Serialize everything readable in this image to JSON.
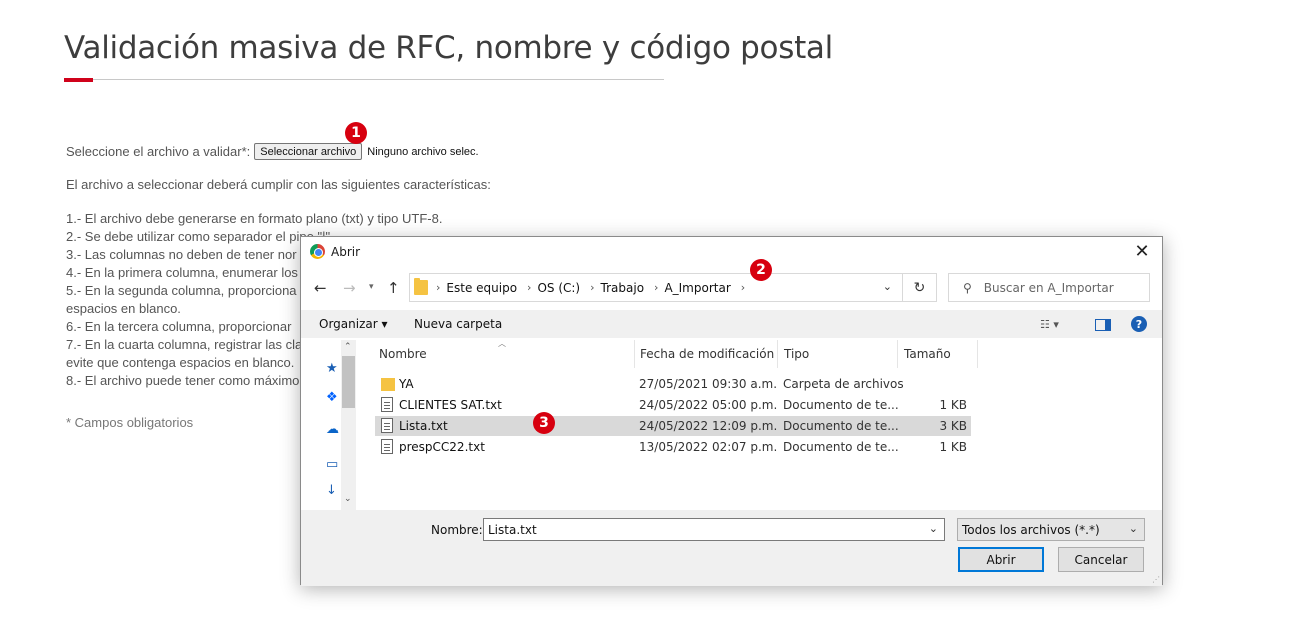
{
  "page": {
    "title": "Validación masiva de RFC, nombre y código postal",
    "select_label": "Seleccione el archivo a validar*:",
    "select_button": "Seleccionar archivo",
    "no_file": "Ninguno archivo selec.",
    "intro": "El archivo a seleccionar deberá cumplir con las siguientes características:",
    "rules": [
      "1.- El archivo debe generarse en formato plano (txt) y tipo UTF-8.",
      "2.- Se debe utilizar como separador el pipe \"|\".",
      "3.- Las columnas no deben de tener nor",
      "4.- En la primera columna, enumerar los",
      "5.- En la segunda columna, proporciona",
      "espacios en blanco.",
      "6.- En la tercera columna, proporcionar",
      "7.- En la cuarta columna, registrar las cla",
      "evite que contenga espacios en blanco.",
      "8.- El archivo puede tener como máximo"
    ],
    "required_note": "* Campos obligatorios"
  },
  "badges": [
    "1",
    "2",
    "3"
  ],
  "dialog": {
    "title": "Abrir",
    "close": "✕",
    "path": [
      "Este equipo",
      "OS (C:)",
      "Trabajo",
      "A_Importar"
    ],
    "search_placeholder": "Buscar en A_Importar",
    "toolbar": {
      "organize": "Organizar ▾",
      "new_folder": "Nueva carpeta"
    },
    "columns": {
      "name": "Nombre",
      "date": "Fecha de modificación",
      "type": "Tipo",
      "size": "Tamaño"
    },
    "files": [
      {
        "name": "YA",
        "date": "27/05/2021 09:30 a.m.",
        "type": "Carpeta de archivos",
        "size": "",
        "kind": "folder"
      },
      {
        "name": "CLIENTES SAT.txt",
        "date": "24/05/2022 05:00 p.m.",
        "type": "Documento de te...",
        "size": "1 KB",
        "kind": "txt"
      },
      {
        "name": "Lista.txt",
        "date": "24/05/2022 12:09 p.m.",
        "type": "Documento de te...",
        "size": "3 KB",
        "kind": "txt"
      },
      {
        "name": "prespCC22.txt",
        "date": "13/05/2022 02:07 p.m.",
        "type": "Documento de te...",
        "size": "1 KB",
        "kind": "txt"
      }
    ],
    "filename_label": "Nombre:",
    "filename_value": "Lista.txt",
    "filetype": "Todos los archivos (*.*)",
    "open_button": "Abrir",
    "cancel_button": "Cancelar"
  },
  "icons": {
    "browser": "chrome-icon",
    "folder": "folder-icon",
    "text_file": "text-file-icon"
  },
  "colors": {
    "accent_red": "#d0021b",
    "badge_red": "#d7000f",
    "selection": "#d9d9d9",
    "focus_blue": "#0078d7"
  }
}
